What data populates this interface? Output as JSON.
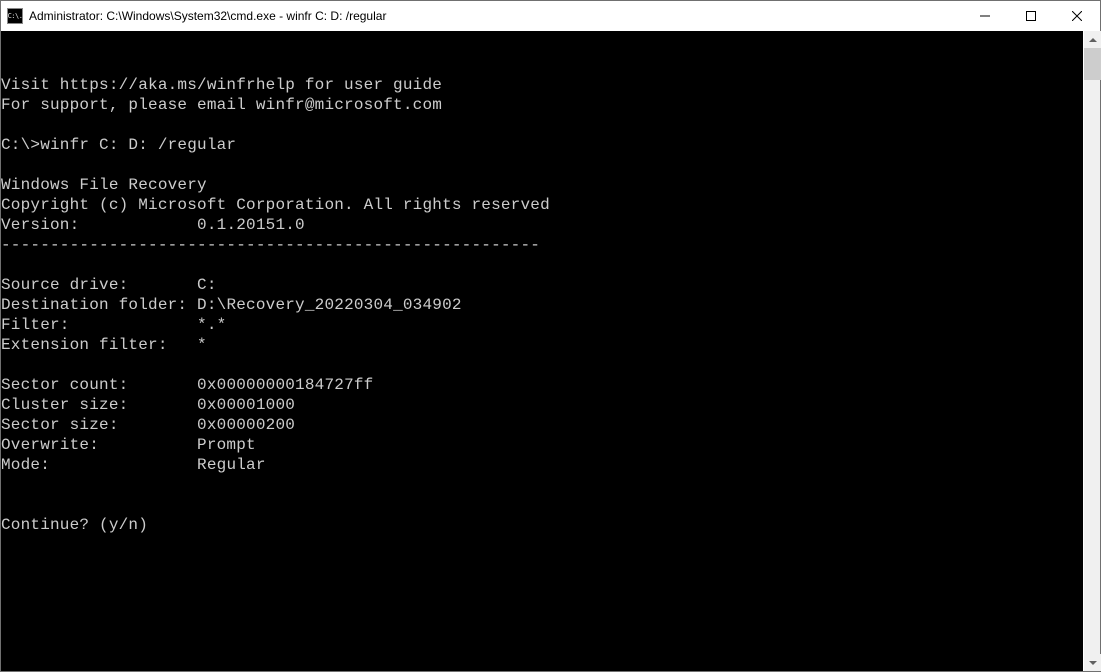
{
  "window": {
    "title": "Administrator: C:\\Windows\\System32\\cmd.exe - winfr  C: D: /regular",
    "icon_label": "C:\\."
  },
  "terminal": {
    "line_help": "Visit https://aka.ms/winfrhelp for user guide",
    "line_support": "For support, please email winfr@microsoft.com",
    "prompt_line": "C:\\>winfr C: D: /regular",
    "header_app": "Windows File Recovery",
    "header_copyright": "Copyright (c) Microsoft Corporation. All rights reserved",
    "version_label": "Version:",
    "version_value": "0.1.20151.0",
    "divider": "-------------------------------------------------------",
    "source_drive_label": "Source drive:",
    "source_drive_value": "C:",
    "dest_folder_label": "Destination folder:",
    "dest_folder_value": "D:\\Recovery_20220304_034902",
    "filter_label": "Filter:",
    "filter_value": "*.*",
    "ext_filter_label": "Extension filter:",
    "ext_filter_value": "*",
    "sector_count_label": "Sector count:",
    "sector_count_value": "0x00000000184727ff",
    "cluster_size_label": "Cluster size:",
    "cluster_size_value": "0x00001000",
    "sector_size_label": "Sector size:",
    "sector_size_value": "0x00000200",
    "overwrite_label": "Overwrite:",
    "overwrite_value": "Prompt",
    "mode_label": "Mode:",
    "mode_value": "Regular",
    "continue_prompt": "Continue? (y/n)"
  }
}
